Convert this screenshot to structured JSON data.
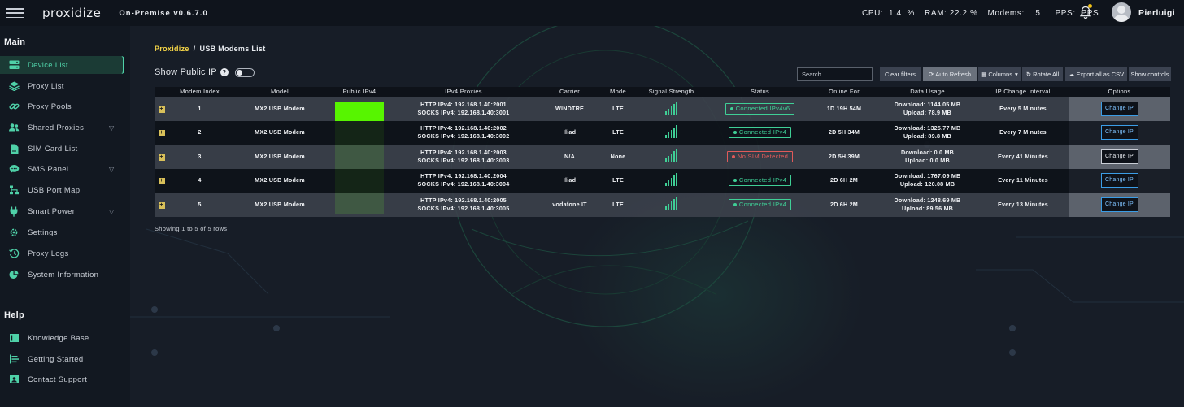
{
  "header": {
    "logo": "proxidize",
    "version": "On-Premise v0.6.7.0",
    "cpu": "CPU:  1.4  %",
    "ram": "RAM: 22.2 %",
    "modems": "Modems:    5",
    "pps": "PPS:  PPS",
    "username": "Pierluigi"
  },
  "sidebar": {
    "main_title": "Main",
    "help_title": "Help",
    "main_items": [
      {
        "label": "Device List",
        "icon": "device-list-icon",
        "active": true
      },
      {
        "label": "Proxy List",
        "icon": "layers-icon"
      },
      {
        "label": "Proxy Pools",
        "icon": "link-icon"
      },
      {
        "label": "Shared Proxies",
        "icon": "users-icon",
        "caret": true
      },
      {
        "label": "SIM Card List",
        "icon": "document-icon"
      },
      {
        "label": "SMS Panel",
        "icon": "chat-icon",
        "caret": true
      },
      {
        "label": "USB Port Map",
        "icon": "sitemap-icon"
      },
      {
        "label": "Smart Power",
        "icon": "plug-icon",
        "caret": true
      },
      {
        "label": "Settings",
        "icon": "gear-icon"
      },
      {
        "label": "Proxy Logs",
        "icon": "history-icon"
      },
      {
        "label": "System Information",
        "icon": "pie-chart-icon"
      }
    ],
    "help_items": [
      {
        "label": "Knowledge Base",
        "icon": "book-icon"
      },
      {
        "label": "Getting Started",
        "icon": "list-icon"
      },
      {
        "label": "Contact Support",
        "icon": "contact-icon"
      }
    ]
  },
  "breadcrumb": {
    "home": "Proxidize",
    "separator": "/",
    "current": "USB Modems List"
  },
  "show_public_ip": {
    "label": "Show Public IP",
    "help": "?"
  },
  "toolbar": {
    "search_placeholder": "Search",
    "clear_filters": "Clear filters",
    "auto_refresh": "Auto Refresh",
    "columns": "Columns",
    "rotate_all": "Rotate All",
    "export_csv": "Export all as CSV",
    "show_controls": "Show controls"
  },
  "table": {
    "columns": [
      "",
      "Modem Index",
      "Model",
      "Public IPv4",
      "IPv4 Proxies",
      "Carrier",
      "Mode",
      "Signal Strength",
      "Status",
      "Online For",
      "Data Usage",
      "IP Change Interval",
      "Options"
    ],
    "rows": [
      {
        "index": "1",
        "model": "MX2 USB Modem",
        "http": "HTTP IPv4: 192.168.1.40:2001",
        "socks": "SOCKS IPv4: 192.168.1.40:3001",
        "carrier": "WINDTRE",
        "mode": "LTE",
        "signal_bars": 5,
        "status": "Connected IPv4v6",
        "status_ok": true,
        "online": "1D 19H 54M",
        "download": "Download: 1144.05 MB",
        "upload": "Upload: 78.9 MB",
        "interval": "Every 5 Minutes",
        "action": "Change IP",
        "action_style": "blue"
      },
      {
        "index": "2",
        "model": "MX2 USB Modem",
        "http": "HTTP IPv4: 192.168.1.40:2002",
        "socks": "SOCKS IPv4: 192.168.1.40:3002",
        "carrier": "Iliad",
        "mode": "LTE",
        "signal_bars": 5,
        "status": "Connected IPv4",
        "status_ok": true,
        "online": "2D 5H 34M",
        "download": "Download: 1325.77 MB",
        "upload": "Upload: 89.8 MB",
        "interval": "Every 7 Minutes",
        "action": "Change IP",
        "action_style": "blue"
      },
      {
        "index": "3",
        "model": "MX2 USB Modem",
        "http": "HTTP IPv4: 192.168.1.40:2003",
        "socks": "SOCKS IPv4: 192.168.1.40:3003",
        "carrier": "N/A",
        "mode": "None",
        "signal_bars": 5,
        "status": "No SIM Detected",
        "status_ok": false,
        "online": "2D 5H 39M",
        "download": "Download: 0.0 MB",
        "upload": "Upload: 0.0 MB",
        "interval": "Every 41 Minutes",
        "action": "Change IP",
        "action_style": "neutral"
      },
      {
        "index": "4",
        "model": "MX2 USB Modem",
        "http": "HTTP IPv4: 192.168.1.40:2004",
        "socks": "SOCKS IPv4: 192.168.1.40:3004",
        "carrier": "Iliad",
        "mode": "LTE",
        "signal_bars": 5,
        "status": "Connected IPv4",
        "status_ok": true,
        "online": "2D 6H 2M",
        "download": "Download: 1767.09 MB",
        "upload": "Upload: 120.08 MB",
        "interval": "Every 11 Minutes",
        "action": "Change IP",
        "action_style": "blue"
      },
      {
        "index": "5",
        "model": "MX2 USB Modem",
        "http": "HTTP IPv4: 192.168.1.40:2005",
        "socks": "SOCKS IPv4: 192.168.1.40:3005",
        "carrier": "vodafone IT",
        "mode": "LTE",
        "signal_bars": 5,
        "status": "Connected IPv4",
        "status_ok": true,
        "online": "2D 6H 2M",
        "download": "Download: 1248.69 MB",
        "upload": "Upload: 89.56 MB",
        "interval": "Every 13 Minutes",
        "action": "Change IP",
        "action_style": "blue"
      }
    ]
  },
  "footer": {
    "showing": "Showing 1 to 5 of 5 rows"
  },
  "colors": {
    "accent_green": "#3fcf96",
    "breadcrumb_yellow": "#f5d547",
    "error_red": "#e05a5a",
    "ip_redaction_green": "#57f500",
    "button_blue": "#3b9de6"
  }
}
